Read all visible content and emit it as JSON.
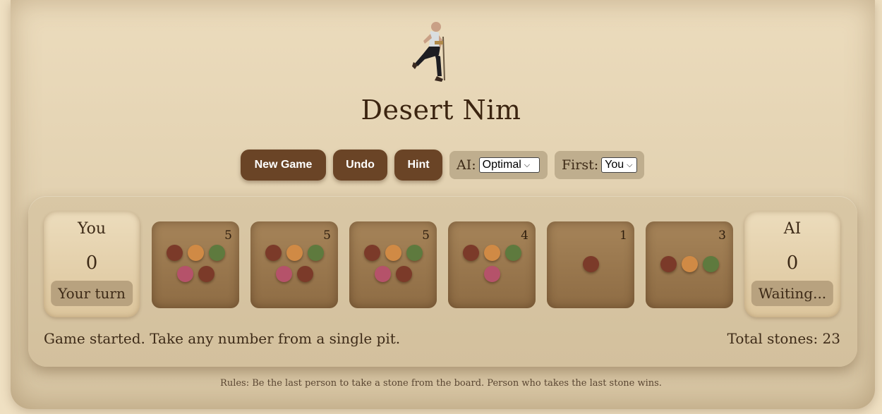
{
  "app": {
    "title": "Desert Nim"
  },
  "controls": {
    "new_game": "New Game",
    "undo": "Undo",
    "hint": "Hint",
    "ai_label": "AI:",
    "ai_value": "Optimal",
    "first_label": "First:",
    "first_value": "You"
  },
  "players": {
    "you": {
      "name": "You",
      "score": "0",
      "status": "Your turn"
    },
    "ai": {
      "name": "AI",
      "score": "0",
      "status": "Waiting..."
    }
  },
  "pits": [
    {
      "count": "5",
      "stones": 5
    },
    {
      "count": "5",
      "stones": 5
    },
    {
      "count": "5",
      "stones": 5
    },
    {
      "count": "4",
      "stones": 4
    },
    {
      "count": "1",
      "stones": 1
    },
    {
      "count": "3",
      "stones": 3
    }
  ],
  "stone_colors": [
    "#7b3a29",
    "#d08a45",
    "#5e7a3e",
    "#b5526a",
    "#7b3a29"
  ],
  "status_message": "Game started. Take any number from a single pit.",
  "total_stones": "Total stones: 23",
  "rules": "Rules: Be the last person to take a stone from the board. Person who takes the last stone wins.",
  "colors": {
    "button": "#6a4426",
    "pit": "#9a7a50",
    "background": "#efe0c2"
  }
}
